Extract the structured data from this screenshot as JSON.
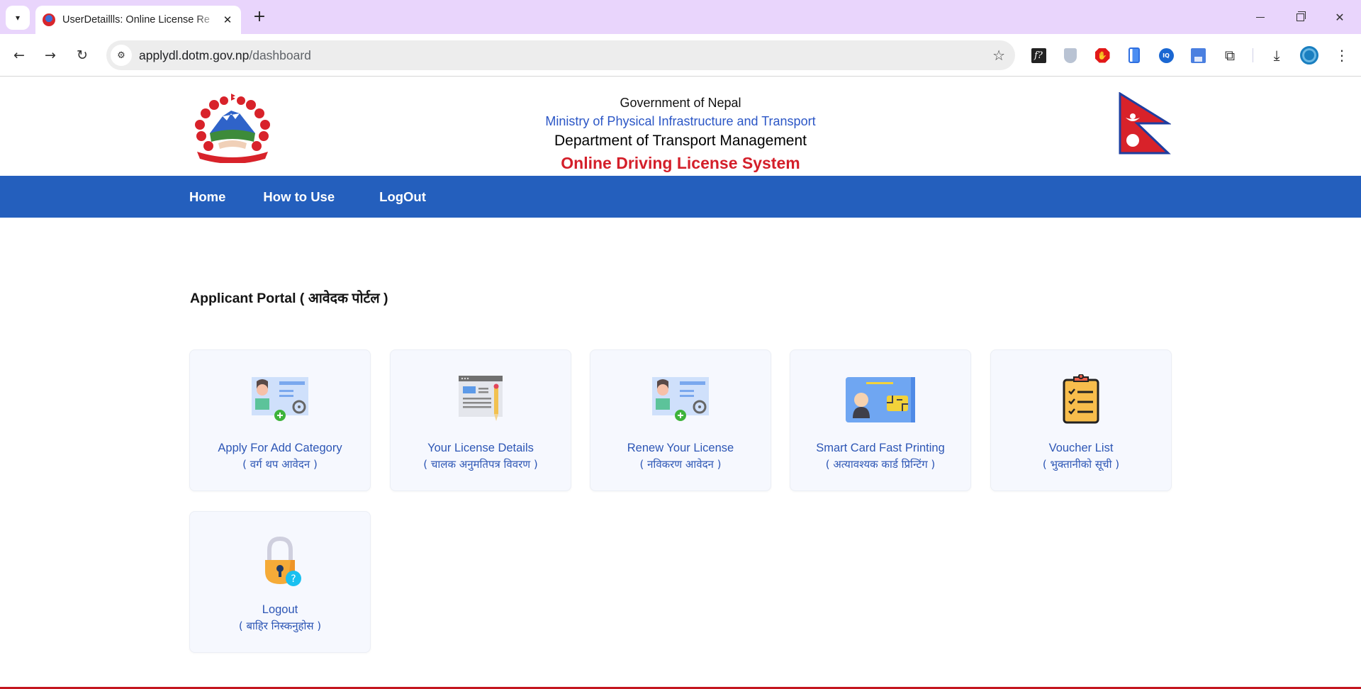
{
  "browser": {
    "tab_title": "UserDetaillls: Online License Re",
    "url_host": "applydl.dotm.gov.np",
    "url_path": "/dashboard",
    "tab_list_icon": "chevron-down",
    "close_tab_glyph": "✕",
    "new_tab_glyph": "+",
    "back_glyph": "←",
    "forward_glyph": "→",
    "reload_glyph": "↻",
    "site_info_glyph": "⚙",
    "star_glyph": "☆",
    "extensions": [
      "font-identifier",
      "privacy-shield",
      "adblock",
      "phone-mirror",
      "iq-extension",
      "save-page",
      "extensions-puzzle"
    ],
    "ext_fx_label": "f?",
    "ext_iq_label": "IQ",
    "ext_stop_glyph": "✋",
    "puzzle_glyph": "⧉",
    "download_glyph": "⤓",
    "menu_glyph": "⋮",
    "window_close_glyph": "✕"
  },
  "header": {
    "line1": "Government of Nepal",
    "line2": "Ministry of Physical Infrastructure and Transport",
    "line3": "Department of Transport Management",
    "line4": "Online Driving License System"
  },
  "nav": {
    "items": [
      {
        "label": "Home"
      },
      {
        "label": "How to Use"
      },
      {
        "label": "LogOut"
      }
    ]
  },
  "main": {
    "title": "Applicant Portal ( आवेदक पोर्टल )",
    "cards": [
      {
        "title": "Apply For Add Category",
        "subtitle": "( वर्ग थप आवेदन )",
        "icon": "license-add-icon"
      },
      {
        "title": "Your License Details",
        "subtitle": "( चालक अनुमतिपत्र विवरण )",
        "icon": "document-edit-icon"
      },
      {
        "title": "Renew Your License",
        "subtitle": "( नविकरण आवेदन )",
        "icon": "license-renew-icon"
      },
      {
        "title": "Smart Card Fast Printing",
        "subtitle": "( अत्यावश्यक कार्ड प्रिन्टिंग )",
        "icon": "smart-card-icon"
      },
      {
        "title": "Voucher List",
        "subtitle": "( भुक्तानीको सूची )",
        "icon": "clipboard-checklist-icon"
      },
      {
        "title": "Logout",
        "subtitle": "( बाहिर निस्कनुहोस )",
        "icon": "lock-question-icon"
      }
    ]
  },
  "colors": {
    "tabbar": "#e9d5fc",
    "navbar": "#245fbd",
    "accent_blue": "#2d56b5",
    "accent_red": "#d41f2a",
    "card_bg": "#f6f8fe"
  }
}
